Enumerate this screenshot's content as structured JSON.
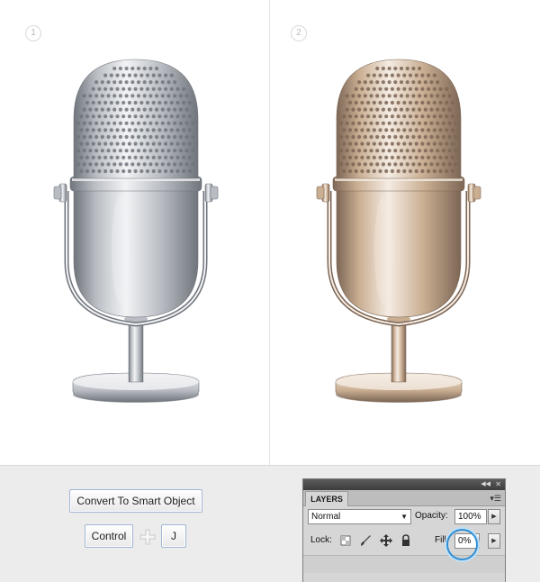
{
  "steps": [
    {
      "number": "1"
    },
    {
      "number": "2"
    }
  ],
  "colors": {
    "chrome_highlight": "#f2f3f5",
    "chrome_mid": "#b9bdc3",
    "chrome_shadow": "#70757c",
    "bronze_highlight": "#f5ece3",
    "bronze_mid": "#c9ae92",
    "bronze_shadow": "#7c6655",
    "focus_ring": "#2f8fd6"
  },
  "actions": {
    "convert_label": "Convert To Smart Object",
    "shortcut_modifier": "Control",
    "shortcut_key": "J"
  },
  "layers_panel": {
    "tab_label": "LAYERS",
    "blend_mode": "Normal",
    "opacity_label": "Opacity:",
    "opacity_value": "100%",
    "lock_label": "Lock:",
    "fill_label": "Fill:",
    "fill_value": "0%"
  }
}
